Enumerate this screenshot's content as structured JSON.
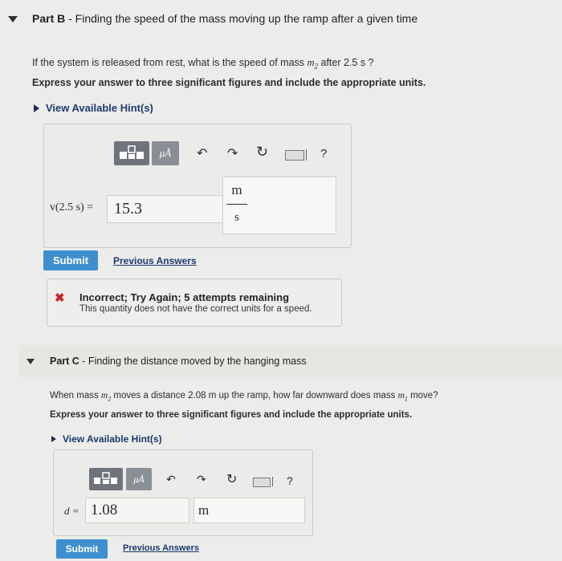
{
  "partB": {
    "title_prefix": "Part B",
    "title_rest": " - Finding the speed of the mass moving up the ramp after a given time",
    "question_pre": "If the system is released from rest, what is the speed of mass ",
    "question_var": "m",
    "question_sub": "2",
    "question_post": " after 2.5  s ?",
    "instruction": "Express your answer to three significant figures and include the appropriate units.",
    "hint_link": "View Available Hint(s)",
    "answer_label": "v(2.5 s) =",
    "answer_value": "15.3",
    "unit_numerator": "m",
    "unit_denominator": "s",
    "submit_label": "Submit",
    "previous_label": "Previous Answers",
    "feedback_title": "Incorrect; Try Again; 5 attempts remaining",
    "feedback_detail": "This quantity does not have the correct units for a speed."
  },
  "partC": {
    "title_prefix": "Part C",
    "title_rest": " - Finding the distance moved by the hanging mass",
    "question_pre": "When mass ",
    "question_var": "m",
    "question_sub": "2",
    "question_mid": " moves a distance 2.08  m up the ramp, how far downward does mass ",
    "question_var2": "m",
    "question_sub2": "1",
    "question_post": " move?",
    "instruction": "Express your answer to three significant figures and include the appropriate units.",
    "hint_link": "View Available Hint(s)",
    "answer_label": "d =",
    "answer_value": "1.08",
    "unit_value": "m",
    "submit_label": "Submit",
    "previous_label": "Previous Answers"
  },
  "toolbar": {
    "units_glyph": "μÅ",
    "help_glyph": "?"
  },
  "colors": {
    "accent": "#3f8fcf",
    "error": "#c62828",
    "link": "#1c3a6e"
  }
}
